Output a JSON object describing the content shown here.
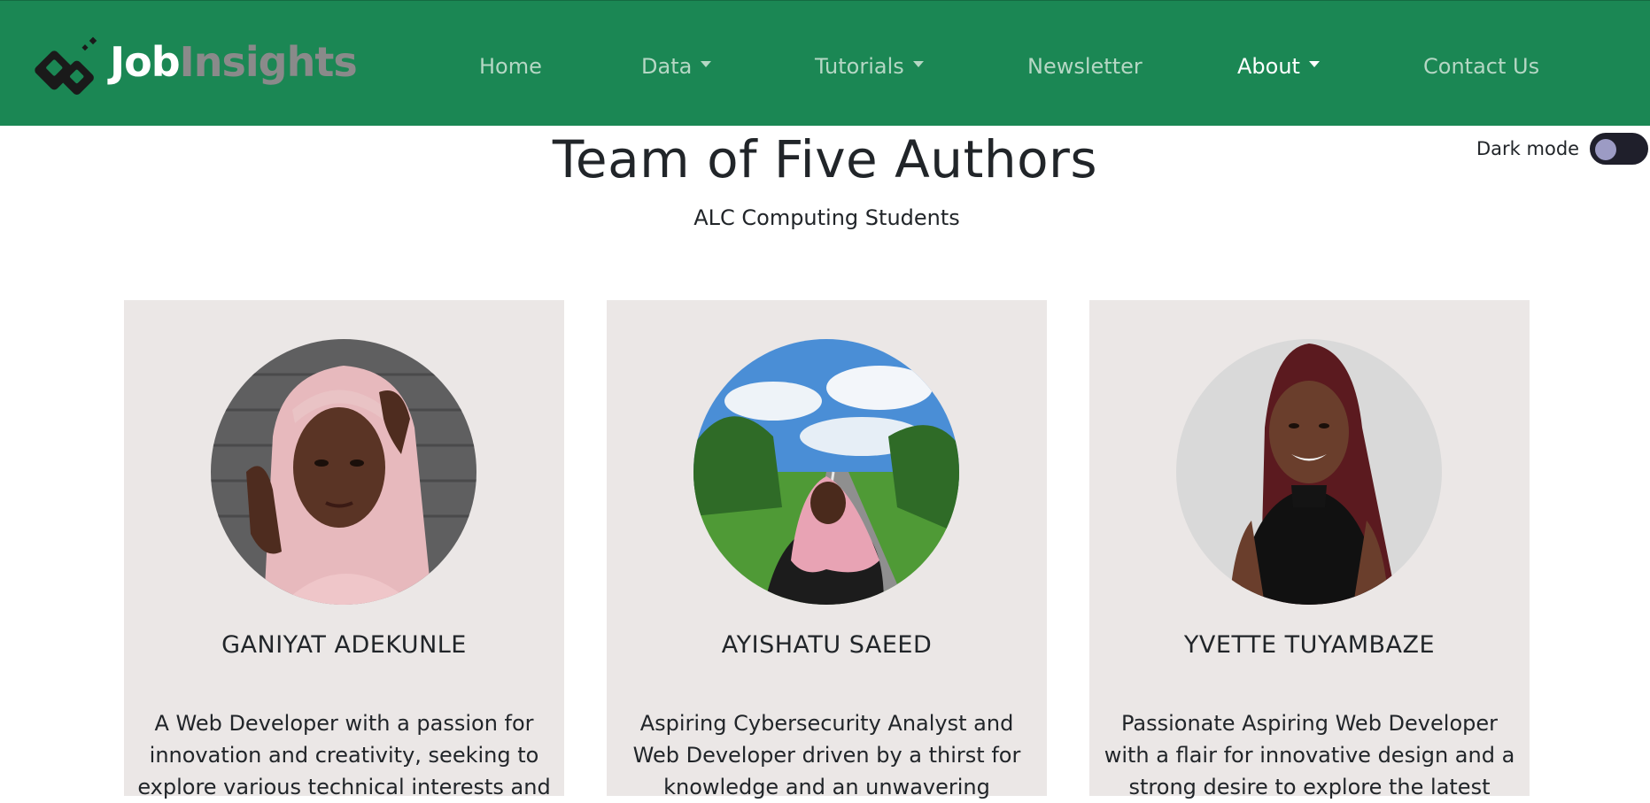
{
  "navbar": {
    "brand_part1": "Job",
    "brand_part2": "Insights",
    "items": [
      {
        "label": "Home"
      },
      {
        "label": "Data"
      },
      {
        "label": "Tutorials"
      },
      {
        "label": "Newsletter"
      },
      {
        "label": "About"
      },
      {
        "label": "Contact Us"
      }
    ],
    "active_item": "About",
    "background": "#1b8754"
  },
  "header": {
    "title": "Team of Five Authors",
    "subtitle": "ALC Computing Students"
  },
  "dark_mode": {
    "label": "Dark mode",
    "enabled": false
  },
  "team": [
    {
      "name": "GANIYAT ADEKUNLE",
      "bio": "A Web Developer with a passion for innovation and creativity, seeking to explore various technical interests and",
      "photo_icon": "person-portrait-photo"
    },
    {
      "name": "AYISHATU SAEED",
      "bio": "Aspiring Cybersecurity Analyst and Web Developer driven by a thirst for knowledge and an unwavering",
      "photo_icon": "person-portrait-photo"
    },
    {
      "name": "YVETTE TUYAMBAZE",
      "bio": "Passionate Aspiring Web Developer with a flair for innovative design and a strong desire to explore the latest",
      "photo_icon": "person-portrait-photo"
    }
  ]
}
